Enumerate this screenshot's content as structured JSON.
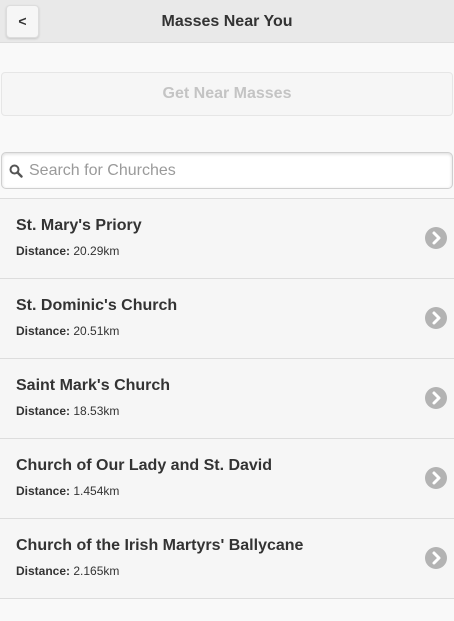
{
  "header": {
    "back_label": "<",
    "title": "Masses Near You"
  },
  "near_button": {
    "label": "Get Near Masses"
  },
  "search": {
    "placeholder": "Search for Churches",
    "value": ""
  },
  "distance_label": "Distance:",
  "churches": [
    {
      "name": "St. Mary's Priory",
      "distance": "20.29km"
    },
    {
      "name": "St. Dominic's Church",
      "distance": "20.51km"
    },
    {
      "name": "Saint Mark's Church",
      "distance": "18.53km"
    },
    {
      "name": "Church of Our Lady and St. David",
      "distance": "1.454km"
    },
    {
      "name": "Church of the Irish Martyrs' Ballycane",
      "distance": "2.165km"
    }
  ],
  "icons": {
    "search": "search-icon",
    "arrow": "chevron-right-icon"
  },
  "colors": {
    "header_bg": "#e9e9e9",
    "list_bg": "#f6f6f6",
    "arrow_bg": "#b3b3b3"
  }
}
